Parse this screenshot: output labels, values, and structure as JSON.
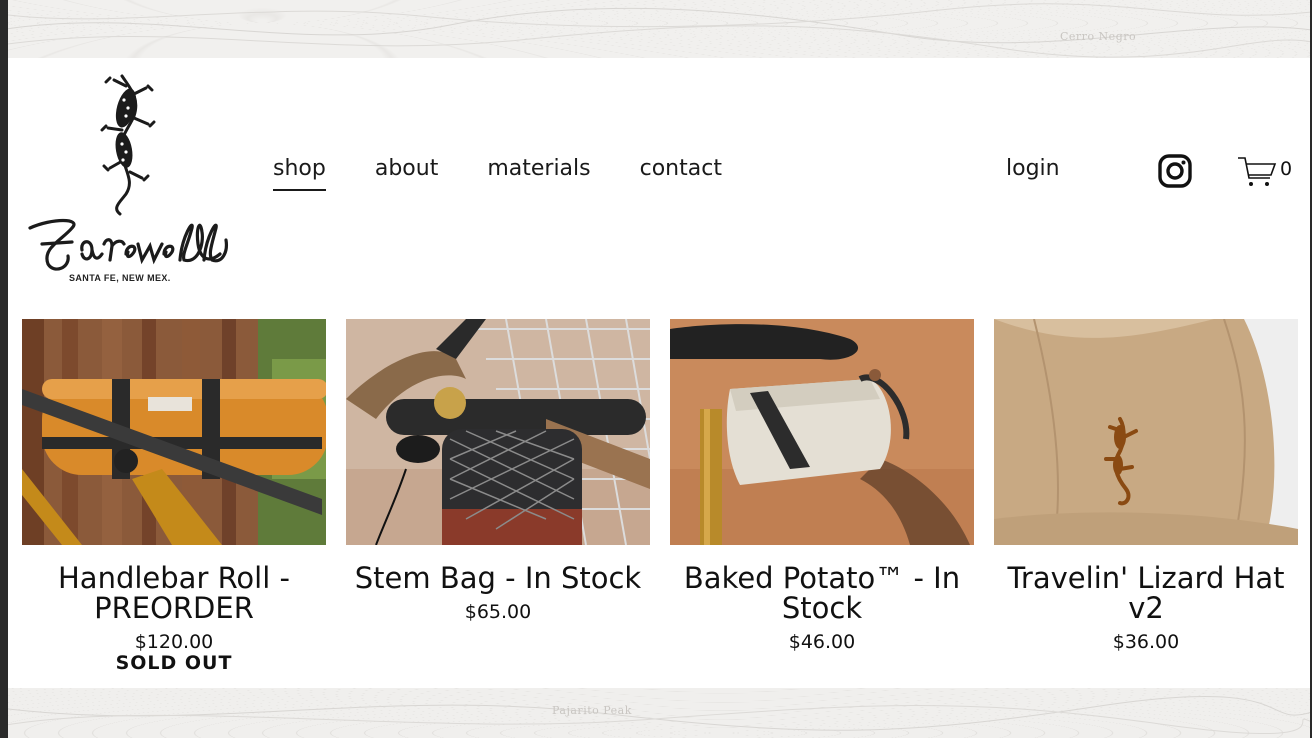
{
  "brand": {
    "script_name": "Farewell",
    "tagline": "SANTA FE, NEW MEX."
  },
  "background_labels": [
    "Pajarito Peak",
    "Cerro Negro"
  ],
  "nav": [
    {
      "label": "shop",
      "active": true
    },
    {
      "label": "about",
      "active": false
    },
    {
      "label": "materials",
      "active": false
    },
    {
      "label": "contact",
      "active": false
    }
  ],
  "account": {
    "login_label": "login"
  },
  "social": {
    "icon": "instagram-icon"
  },
  "cart": {
    "icon": "cart-icon",
    "count": "0"
  },
  "products": [
    {
      "title": "Handlebar Roll - PREORDER",
      "price": "$120.00",
      "badge": "SOLD OUT"
    },
    {
      "title": "Stem Bag - In Stock",
      "price": "$65.00",
      "badge": ""
    },
    {
      "title": "Baked Potato™ - In Stock",
      "price": "$46.00",
      "badge": ""
    },
    {
      "title": "Travelin' Lizard Hat v2",
      "price": "$36.00",
      "badge": ""
    }
  ],
  "colors": {
    "text": "#111111",
    "background": "#ffffff",
    "bag_orange": "#d98a2a",
    "hat_tan": "#cdb08e",
    "lizard_embroidery": "#8a4a12"
  }
}
